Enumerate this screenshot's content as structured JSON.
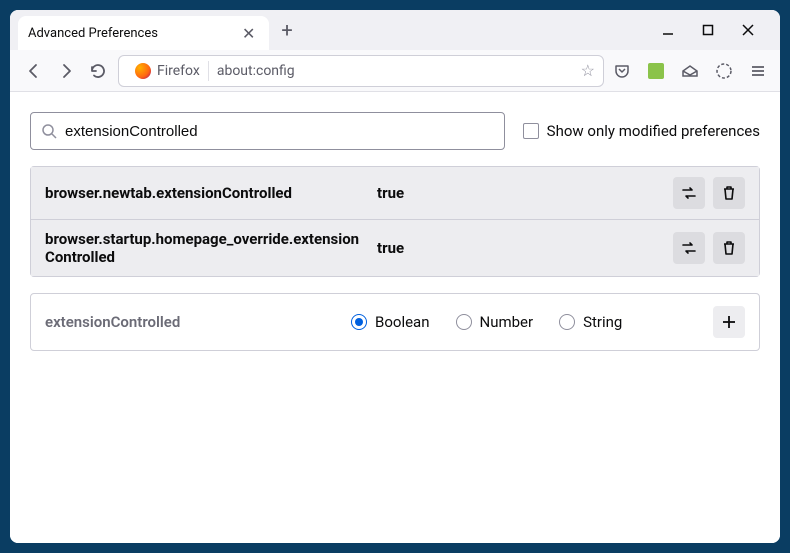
{
  "window": {
    "tab_title": "Advanced Preferences"
  },
  "toolbar": {
    "identity": "Firefox",
    "url": "about:config"
  },
  "search": {
    "value": "extensionControlled",
    "checkbox_label": "Show only modified preferences"
  },
  "prefs": [
    {
      "name": "browser.newtab.extensionControlled",
      "value": "true",
      "modified": true
    },
    {
      "name": "browser.startup.homepage_override.extensionControlled",
      "value": "true",
      "modified": true
    }
  ],
  "new_pref": {
    "name": "extensionControlled",
    "types": [
      "Boolean",
      "Number",
      "String"
    ],
    "selected": "Boolean"
  }
}
